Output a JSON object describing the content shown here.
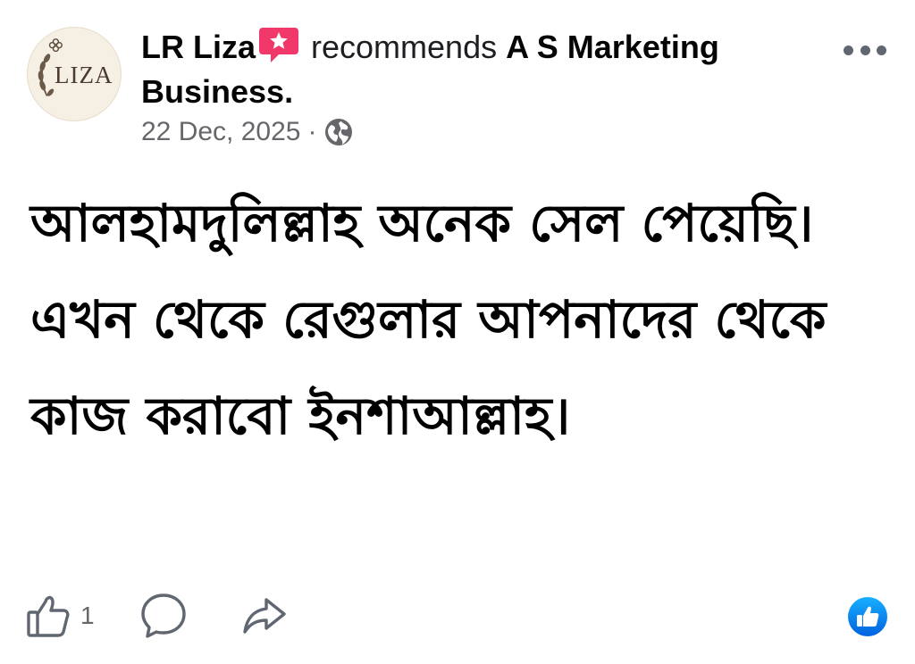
{
  "post": {
    "author": {
      "name": "LR Liza",
      "avatar_text": "LIZA",
      "badge_icon": "recommend-star-icon"
    },
    "action_text": "recommends",
    "page_name": "A S Marketing Business.",
    "date": "22 Dec, 2025",
    "separator": "·",
    "privacy_icon": "globe-icon",
    "more_icon": "more-options-icon",
    "body_text": "আলহামদুলিল্লাহ অনেক সেল পেয়েছি। এখন থেকে রেগুলার আপনাদের থেকে কাজ করাবো ইনশাআল্লাহ।"
  },
  "footer": {
    "like_icon": "thumbs-up-icon",
    "like_count": "1",
    "comment_icon": "comment-icon",
    "share_icon": "share-icon",
    "reaction_icon": "like-reaction-icon"
  },
  "colors": {
    "badge_pink": "#f0386b",
    "secondary_text": "#65676b",
    "reaction_blue": "#1877f2",
    "text": "#050505"
  }
}
